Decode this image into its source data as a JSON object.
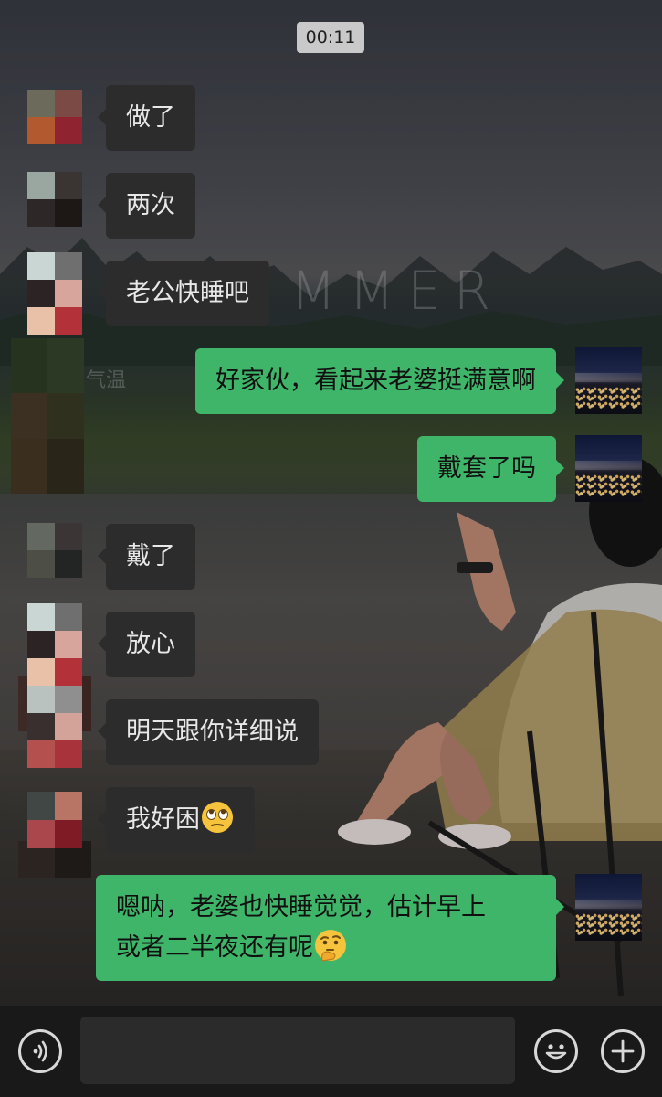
{
  "status": {
    "time": "00:11"
  },
  "wallpaper": {
    "watermark_text": "MMER",
    "side_text": "气温"
  },
  "messages": [
    {
      "side": "left",
      "text": "做了"
    },
    {
      "side": "left",
      "text": "两次"
    },
    {
      "side": "left",
      "text": "老公快睡吧"
    },
    {
      "side": "right",
      "text": "好家伙，看起来老婆挺满意啊"
    },
    {
      "side": "right",
      "text": "戴套了吗"
    },
    {
      "side": "left",
      "text": "戴了"
    },
    {
      "side": "left",
      "text": "放心"
    },
    {
      "side": "left",
      "text": "明天跟你详细说"
    },
    {
      "side": "left",
      "text": "我好困",
      "emoji": "rolling-eyes-emoji"
    },
    {
      "side": "right",
      "text_line1": "嗯呐，老婆也快睡觉觉，估计早上",
      "text_line2": "或者二半夜还有呢",
      "emoji": "thinking-emoji"
    }
  ],
  "input_bar": {
    "voice_icon": "voice-icon",
    "emoji_icon": "emoji-icon",
    "plus_icon": "plus-icon",
    "input_value": ""
  },
  "colors": {
    "sent_bubble": "#3fb56a",
    "received_bubble": "#2c2c2c",
    "input_bar": "#191919"
  }
}
